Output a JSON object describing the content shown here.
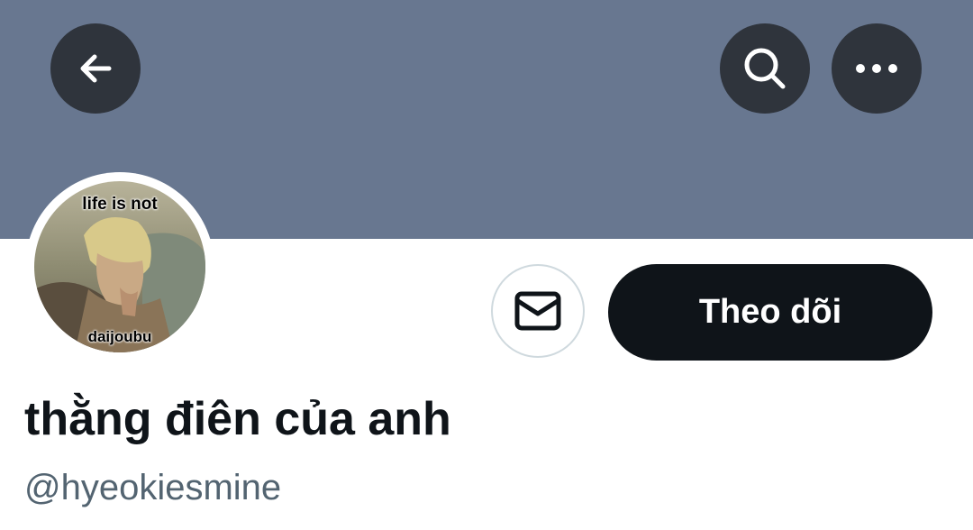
{
  "header": {
    "back_icon": "arrow-left-icon",
    "search_icon": "search-icon",
    "more_icon": "more-horizontal-icon",
    "banner_color": "#687790"
  },
  "profile": {
    "avatar": {
      "caption_top": "life is not",
      "caption_bottom": "daijoubu"
    },
    "message_icon": "envelope-icon",
    "follow_label": "Theo dõi",
    "display_name": "thằng điên của anh",
    "handle": "@hyeokiesmine"
  },
  "colors": {
    "button_dark": "#2f343c",
    "follow_bg": "#0f1419",
    "name_text": "#0f1419",
    "handle_text": "#536471"
  }
}
